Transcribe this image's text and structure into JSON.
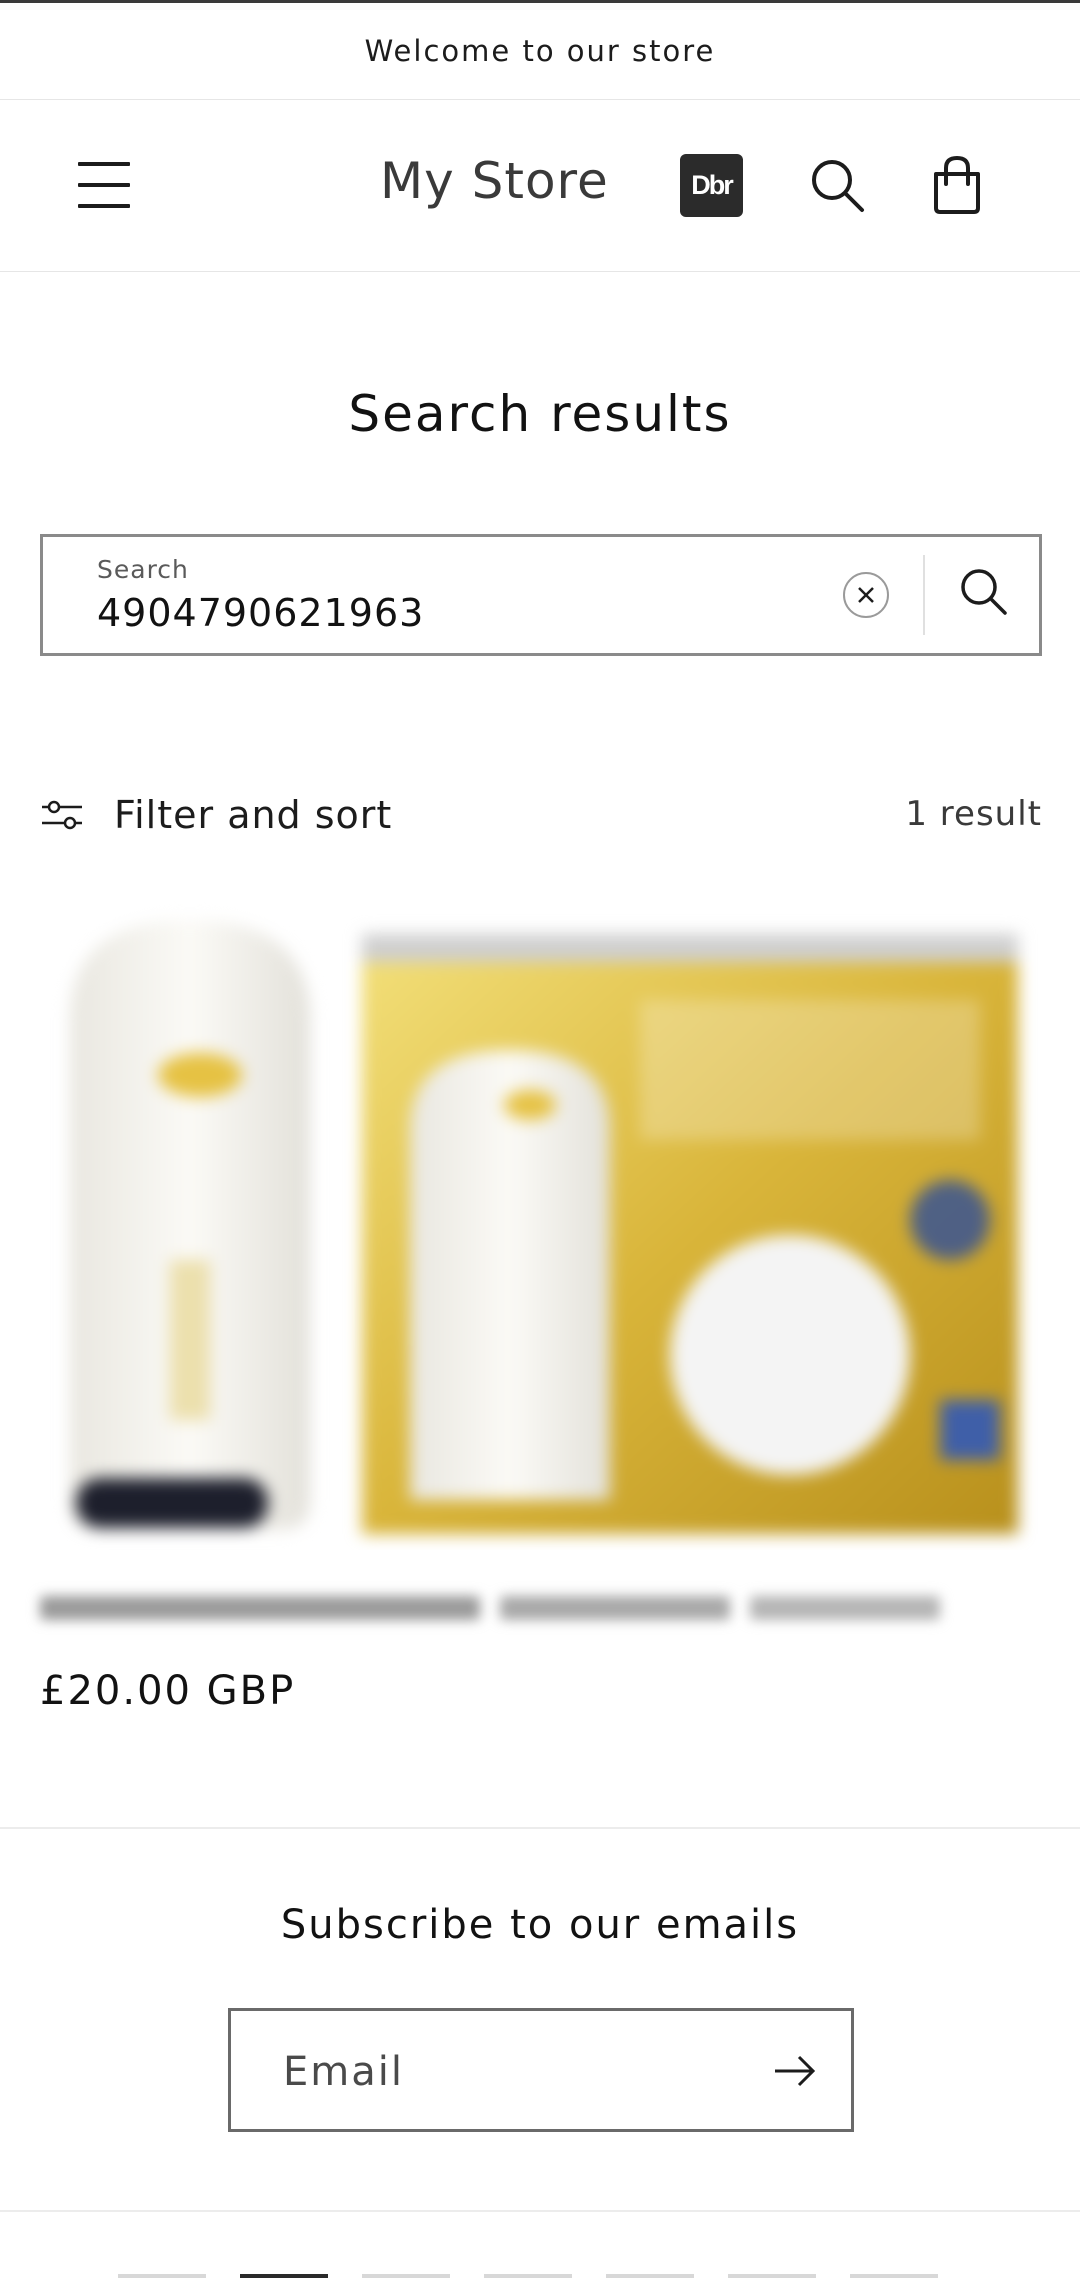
{
  "announcement": {
    "text": "Welcome to our store"
  },
  "header": {
    "store_name": "My Store",
    "badge_text": "Dbr",
    "icons": {
      "menu": "menu-icon",
      "search": "search-icon",
      "cart": "cart-icon"
    }
  },
  "main": {
    "title": "Search results",
    "search": {
      "label": "Search",
      "value": "4904790621963",
      "clear_icon": "close-icon",
      "submit_icon": "search-icon"
    },
    "filter": {
      "label": "Filter and sort",
      "icon": "filter-sliders-icon",
      "result_count": "1 result"
    },
    "products": [
      {
        "price": "£20.00 GBP",
        "image": "blurred-product-image"
      }
    ]
  },
  "footer": {
    "subscribe_title": "Subscribe to our emails",
    "email_placeholder": "Email",
    "submit_icon": "arrow-right-icon"
  },
  "colors": {
    "text": "#121212",
    "border": "#8a8a8a",
    "badge_bg": "#2b2b2b",
    "product_gold": "#d8b43a"
  }
}
